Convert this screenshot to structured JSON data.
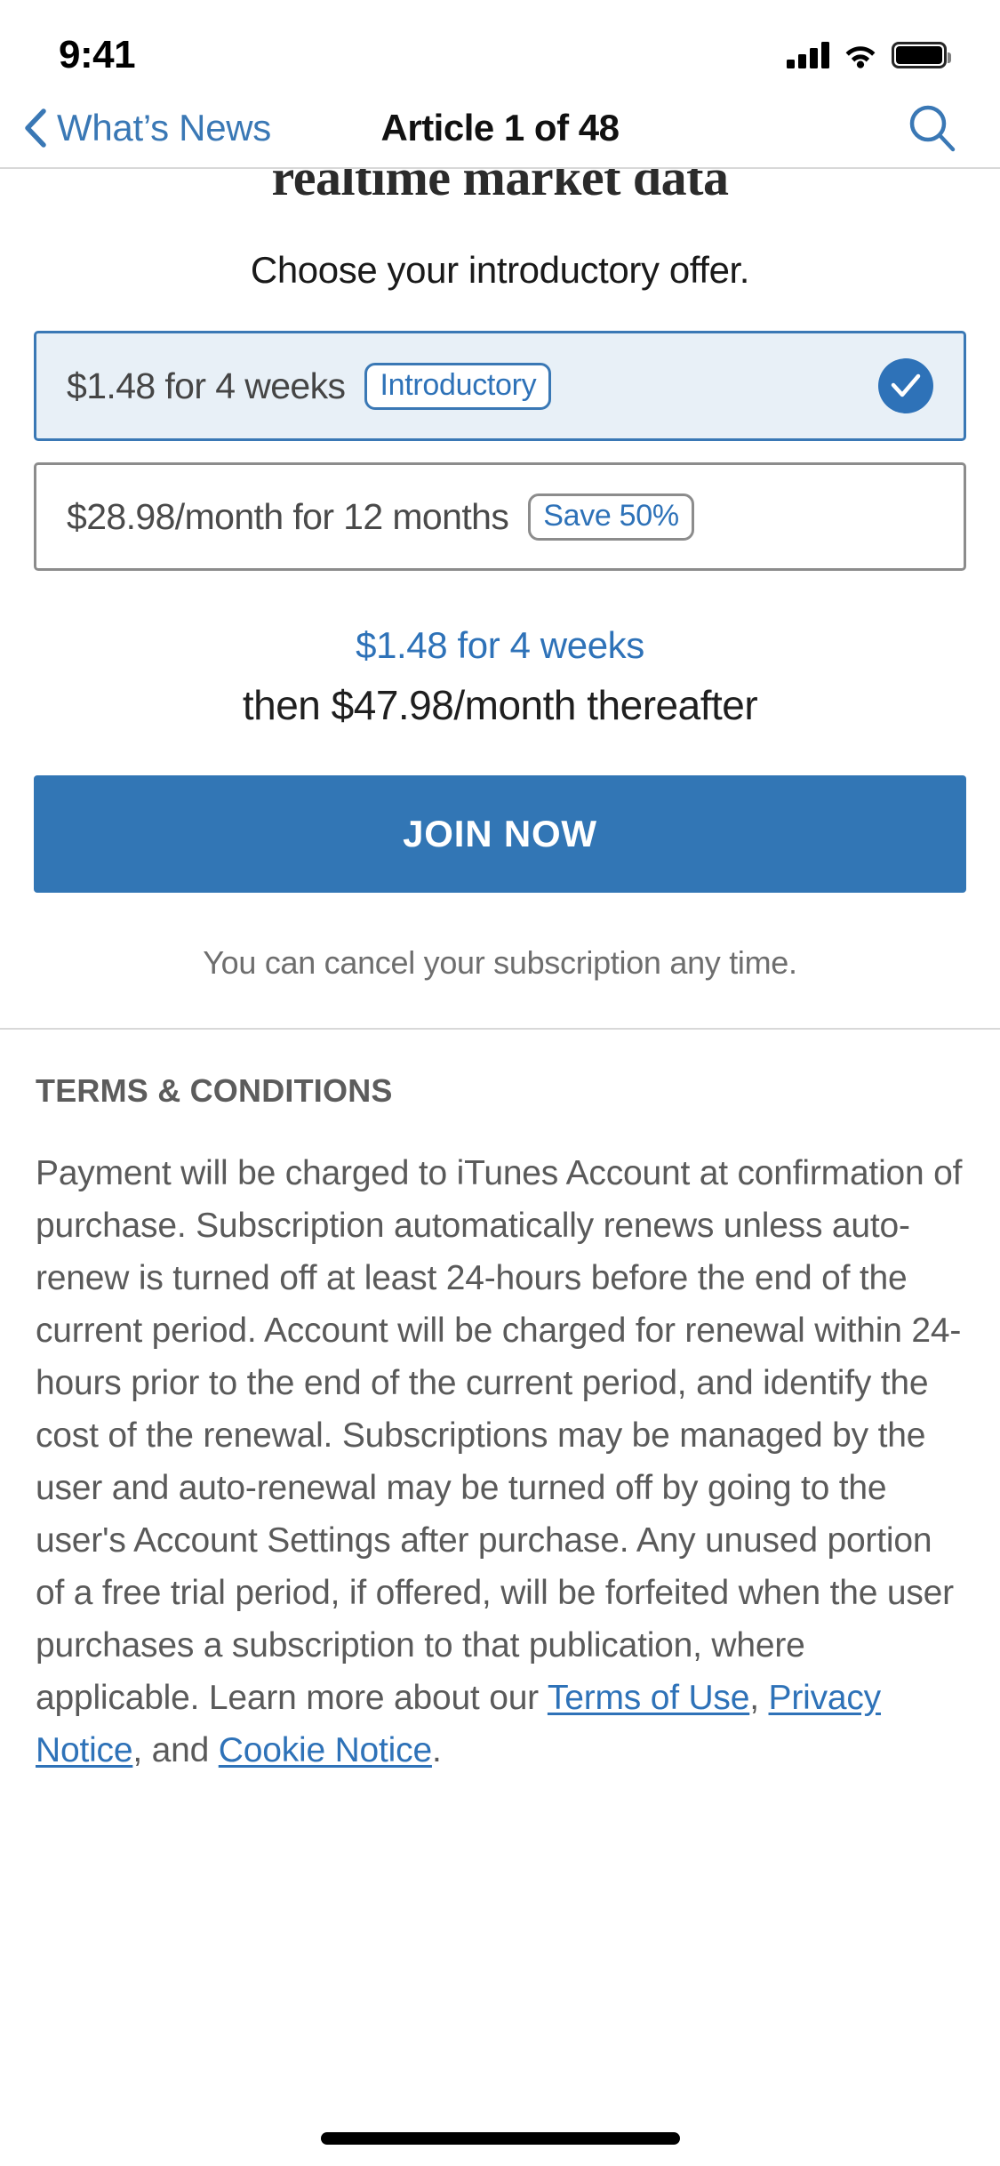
{
  "status_bar": {
    "time": "9:41",
    "cellular_icon": "signal-bars-icon",
    "wifi_icon": "wifi-icon",
    "battery_icon": "battery-full-icon"
  },
  "nav_bar": {
    "back_icon": "chevron-left-icon",
    "back_label": "What’s News",
    "title": "Article 1 of 48",
    "search_icon": "search-icon"
  },
  "article": {
    "clipped_headline": "realtime market data"
  },
  "paywall": {
    "prompt": "Choose your introductory offer.",
    "offers": [
      {
        "price": "$1.48 for 4 weeks",
        "badge": "Introductory",
        "badge_style": "blue",
        "selected": true,
        "check_icon": "check-circle-icon"
      },
      {
        "price": "$28.98/month for 12 months",
        "badge": "Save 50%",
        "badge_style": "gray",
        "selected": false,
        "check_icon": ""
      }
    ],
    "summary_primary": "$1.48 for 4 weeks",
    "summary_secondary": "then $47.98/month thereafter",
    "cta_label": "JOIN NOW",
    "cancel_note": "You can cancel your subscription any time."
  },
  "terms": {
    "heading": "TERMS & CONDITIONS",
    "body_before_links": "Payment will be charged to iTunes Account at confirmation of purchase. Subscription automatically renews unless auto-renew is turned off at least 24-hours before the end of the current period. Account will be charged for renewal within 24-hours prior to the end of the current period, and identify the cost of the renewal. Subscriptions may be managed by the user and auto-renewal may be turned off by going to the user's Account Settings after purchase. Any unused portion of a free trial period, if offered, will be forfeited when the user purchases a subscription to that publication, where applicable. Learn more about our ",
    "link_terms": "Terms of Use",
    "separator_1": ", ",
    "link_privacy": "Privacy Notice",
    "separator_2": ", and ",
    "link_cookie": "Cookie Notice",
    "body_end": "."
  },
  "home_indicator": "home-indicator",
  "colors": {
    "accent_blue": "#2e72b8",
    "cta_blue": "#3276b5",
    "selected_card_bg": "#e8f0f7",
    "selected_card_border": "#3a78b5",
    "card_border": "#8c8c8c",
    "body_text": "#5a5a5a"
  }
}
